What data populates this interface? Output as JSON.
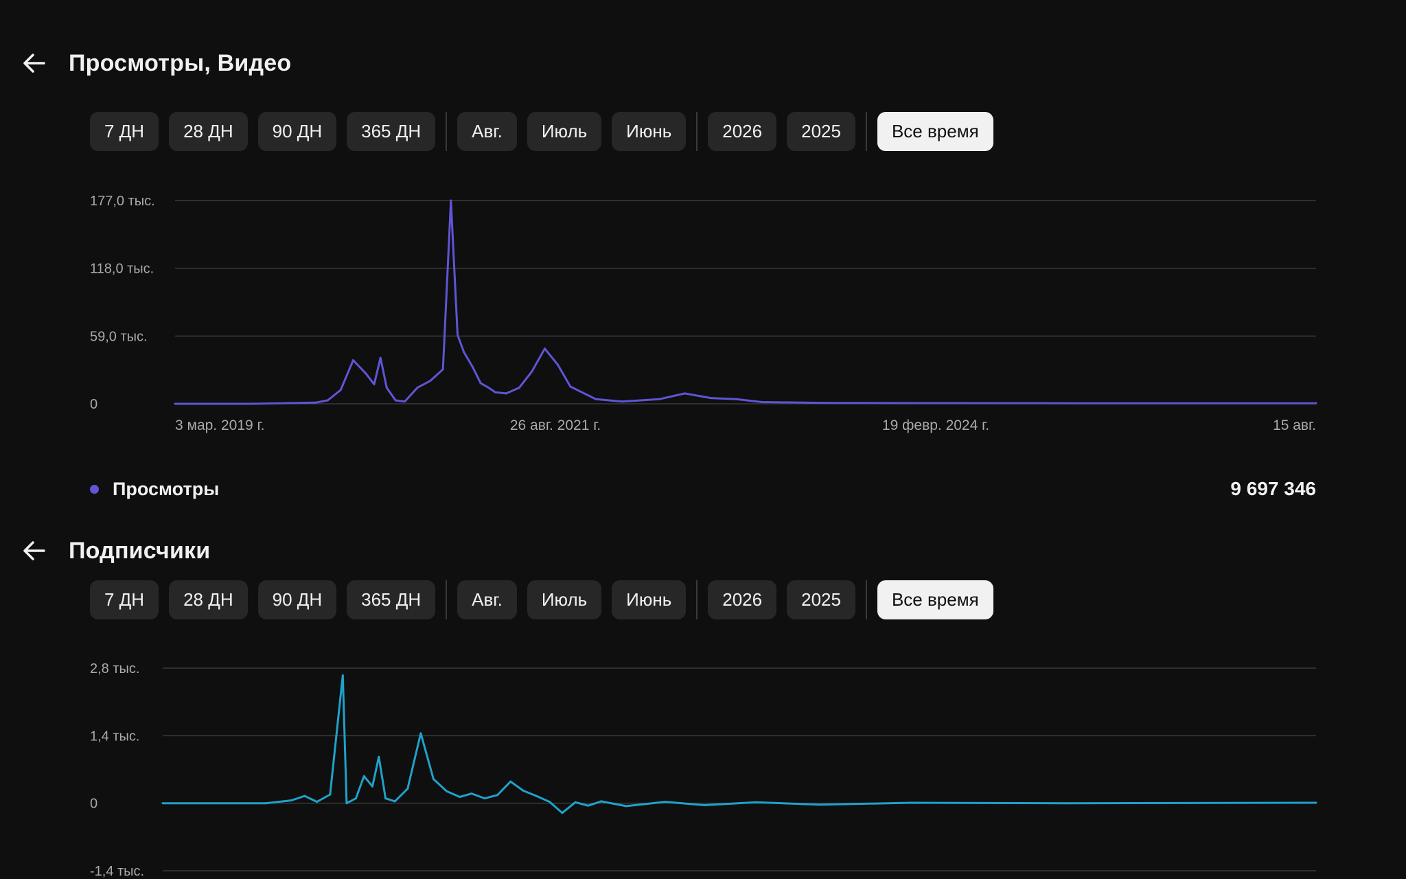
{
  "filters": [
    {
      "label": "7 ДН",
      "group": 0,
      "active": false
    },
    {
      "label": "28 ДН",
      "group": 0,
      "active": false
    },
    {
      "label": "90 ДН",
      "group": 0,
      "active": false
    },
    {
      "label": "365 ДН",
      "group": 0,
      "active": false
    },
    {
      "label": "Авг.",
      "group": 1,
      "active": false
    },
    {
      "label": "Июль",
      "group": 1,
      "active": false
    },
    {
      "label": "Июнь",
      "group": 1,
      "active": false
    },
    {
      "label": "2026",
      "group": 2,
      "active": false
    },
    {
      "label": "2025",
      "group": 2,
      "active": false
    },
    {
      "label": "Все время",
      "group": 3,
      "active": true
    }
  ],
  "views": {
    "title": "Просмотры, Видео",
    "legend": {
      "label": "Просмотры",
      "color": "#5f55d6"
    },
    "total": "9 697 346"
  },
  "subscribers": {
    "title": "Подписчики"
  },
  "chart_data": [
    {
      "type": "line",
      "title": "Просмотры, Видео",
      "ylim": [
        0,
        177000
      ],
      "y_ticks": [
        {
          "value": 177000,
          "label": "177,0 тыс."
        },
        {
          "value": 118000,
          "label": "118,0 тыс."
        },
        {
          "value": 59000,
          "label": "59,0 тыс."
        },
        {
          "value": 0,
          "label": "0"
        }
      ],
      "x_ticks": [
        "3 мар. 2019 г.",
        "26 авг. 2021 г.",
        "19 февр. 2024 г.",
        "15 авг."
      ],
      "x_range": [
        "2019-03-03",
        "2026-08-15"
      ],
      "grid": true,
      "color": "#5f55d6",
      "series": [
        {
          "name": "Просмотры",
          "x": [
            "2019-03-03",
            "2019-09-01",
            "2020-02-01",
            "2020-03-01",
            "2020-04-01",
            "2020-05-01",
            "2020-06-01",
            "2020-06-20",
            "2020-07-05",
            "2020-07-20",
            "2020-08-10",
            "2020-09-01",
            "2020-10-01",
            "2020-11-01",
            "2020-12-01",
            "2020-12-20",
            "2021-01-05",
            "2021-01-20",
            "2021-02-10",
            "2021-03-01",
            "2021-03-20",
            "2021-04-05",
            "2021-05-01",
            "2021-06-01",
            "2021-07-01",
            "2021-08-01",
            "2021-09-01",
            "2021-10-01",
            "2021-12-01",
            "2022-02-01",
            "2022-05-01",
            "2022-07-01",
            "2022-09-01",
            "2022-11-01",
            "2023-01-01",
            "2023-06-01",
            "2024-01-01",
            "2025-01-01",
            "2026-08-15"
          ],
          "values": [
            0,
            0,
            1000,
            3000,
            12000,
            38000,
            26000,
            17000,
            40000,
            14000,
            3000,
            2000,
            14000,
            20000,
            30000,
            177000,
            60000,
            45000,
            32000,
            18000,
            14000,
            10000,
            9000,
            14000,
            28000,
            48000,
            34000,
            15000,
            4000,
            2000,
            4000,
            9000,
            5000,
            4000,
            1500,
            800,
            600,
            500,
            500
          ]
        }
      ]
    },
    {
      "type": "line",
      "title": "Подписчики",
      "ylim": [
        -1400,
        2800
      ],
      "y_ticks": [
        {
          "value": 2800,
          "label": "2,8 тыс."
        },
        {
          "value": 1400,
          "label": "1,4 тыс."
        },
        {
          "value": 0,
          "label": "0"
        },
        {
          "value": -1400,
          "label": "-1,4 тыс."
        }
      ],
      "grid": true,
      "color": "#1fa2c9",
      "series": [
        {
          "x": [
            "2019-03-03",
            "2019-11-01",
            "2020-01-01",
            "2020-02-01",
            "2020-03-01",
            "2020-04-01",
            "2020-05-01",
            "2020-05-10",
            "2020-06-01",
            "2020-06-20",
            "2020-07-10",
            "2020-07-25",
            "2020-08-10",
            "2020-09-01",
            "2020-10-01",
            "2020-11-01",
            "2020-12-01",
            "2021-01-01",
            "2021-02-01",
            "2021-03-01",
            "2021-04-01",
            "2021-05-01",
            "2021-06-01",
            "2021-07-01",
            "2021-08-01",
            "2021-09-01",
            "2021-10-01",
            "2021-11-01",
            "2021-12-01",
            "2022-01-01",
            "2022-03-01",
            "2022-06-01",
            "2022-09-01",
            "2023-01-01",
            "2023-06-01",
            "2024-01-01",
            "2025-01-01",
            "2026-08-15"
          ],
          "values": [
            0,
            0,
            60,
            150,
            30,
            180,
            2650,
            0,
            100,
            560,
            350,
            960,
            100,
            40,
            300,
            1450,
            500,
            250,
            130,
            200,
            100,
            170,
            450,
            260,
            150,
            30,
            -200,
            20,
            -50,
            40,
            -60,
            30,
            -40,
            20,
            -30,
            10,
            0,
            10
          ]
        }
      ]
    }
  ]
}
